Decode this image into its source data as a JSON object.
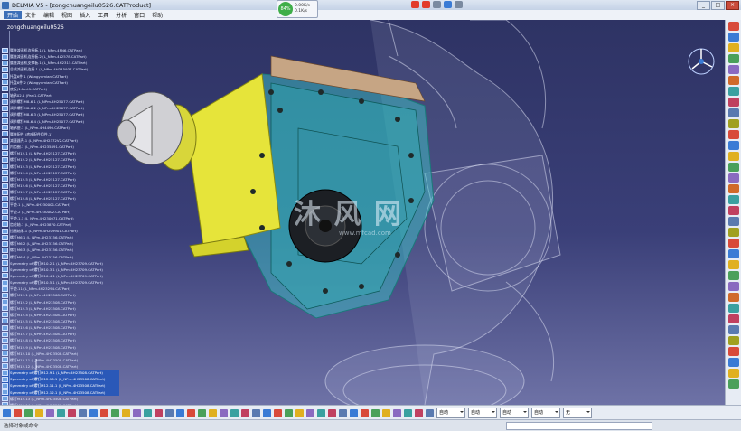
{
  "window": {
    "title": "DELMIA V5 - [zongchuangeilu0526.CATProduct]",
    "buttons": [
      "_",
      "□",
      "×"
    ]
  },
  "menu": {
    "start": "开始",
    "items": [
      "文件",
      "编辑",
      "视图",
      "插入",
      "工具",
      "分析",
      "窗口",
      "帮助"
    ]
  },
  "network": {
    "percent": "84%",
    "up": "0.00K/s",
    "down": "0.1K/s"
  },
  "tree": {
    "root": "zongchuangeilu0526",
    "rows": [
      {
        "text": "腰座减速机连接板.1 (L_NPm-4PN6.CATPart)"
      },
      {
        "text": "腰座减速机连接板.2 (L_NPm-4L2578.CATPart)"
      },
      {
        "text": "腰座减速机支撑板.1 (L_NPm-4H2315.CATPart)"
      },
      {
        "text": "总成减速机连接.1 (L_NPm-4H345937.CATPart)"
      },
      {
        "text": "托盘6件.1 (Wangyumian.CATPart)"
      },
      {
        "text": "托盘6件.2 (Wangyumian.CATPart)"
      },
      {
        "text": "底板(1.Part1.CATPart)"
      },
      {
        "text": "轴承02.1 (Part1.CATPart)"
      },
      {
        "text": "调节螺钉M8-6.1 (L_NPm-4H25077.CATPart)"
      },
      {
        "text": "调节螺钉M8-6.2 (L_NPm-4H25077.CATPart)"
      },
      {
        "text": "调节螺钉M8-6.3 (L_NPm-4H25077.CATPart)"
      },
      {
        "text": "调节螺钉M8-6.4 (L_NPm-4H25077.CATPart)"
      },
      {
        "text": "轴承座.1 (L_NPm-4H4490.CATPart)"
      },
      {
        "text": "腰座配件 (底座配件组件.1)"
      },
      {
        "text": "减速器壳.1 (L_NPm-4H2372V2.CATPart)"
      },
      {
        "text": "内齿圈.1 (L_NPm-4H235891.CATPart)"
      },
      {
        "text": "螺钉M12.1 (L_NPm-4H25127.CATPart)"
      },
      {
        "text": "螺钉M12.2 (L_NPm-4H25127.CATPart)"
      },
      {
        "text": "螺钉M12.3 (L_NPm-4H25127.CATPart)"
      },
      {
        "text": "螺钉M12.4 (L_NPm-4H25127.CATPart)"
      },
      {
        "text": "螺钉M12.5 (L_NPm-4H25127.CATPart)"
      },
      {
        "text": "螺钉M12.6 (L_NPm-4H25127.CATPart)"
      },
      {
        "text": "螺钉M12.7 (L_NPm-4H25127.CATPart)"
      },
      {
        "text": "螺钉M12.8 (L_NPm-4H25127.CATPart)"
      },
      {
        "text": "平垫.1 (L_NPm-4H230001.CATPart)"
      },
      {
        "text": "平垫.2 (L_NPm-4H230002.CATPart)"
      },
      {
        "text": "平垫.1.1 (L_NPm-4H230071.CATPart)"
      },
      {
        "text": "齿轮轴.1 (L_NPm-4H23870.CATPart)"
      },
      {
        "text": "挡圈轴承.1 (L_NPm-4H209901.CATPart)"
      },
      {
        "text": "螺钉M6.1 (L_NPm-4H23156.CATPart)"
      },
      {
        "text": "螺钉M6.2 (L_NPm-4H23156.CATPart)"
      },
      {
        "text": "螺钉M6.3 (L_NPm-4H23156.CATPart)"
      },
      {
        "text": "螺钉M6.4 (L_NPm-4H23156.CATPart)"
      },
      {
        "text": "Symmetry of 螺钉M10.2.1 (L_NPm-4H23709.CATPart)"
      },
      {
        "text": "Symmetry of 螺钉M10.3.1 (L_NPm-4H23709.CATPart)"
      },
      {
        "text": "Symmetry of 螺钉M10.4.1 (L_NPm-4H23709.CATPart)"
      },
      {
        "text": "Symmetry of 螺钉M10.5.1 (L_NPm-4H23709.CATPart)"
      },
      {
        "text": "平垫.11 (L_NPm-4H23294.CATPart)"
      },
      {
        "text": "螺钉M12.1 (L_NPm-4H23508.CATPart)"
      },
      {
        "text": "螺钉M12.2 (L_NPm-4H23508.CATPart)"
      },
      {
        "text": "螺钉M12.3 (L_NPm-4H23508.CATPart)"
      },
      {
        "text": "螺钉M12.4 (L_NPm-4H23508.CATPart)"
      },
      {
        "text": "螺钉M12.5 (L_NPm-4H23508.CATPart)"
      },
      {
        "text": "螺钉M12.6 (L_NPm-4H23508.CATPart)"
      },
      {
        "text": "螺钉M12.7 (L_NPm-4H23508.CATPart)"
      },
      {
        "text": "螺钉M12.8 (L_NPm-4H23508.CATPart)"
      },
      {
        "text": "螺钉M12.9 (L_NPm-4H23508.CATPart)"
      },
      {
        "text": "螺钉M12.10 (L_NPm-4H23508.CATPart)"
      },
      {
        "text": "螺钉M12.11 (L_NPm-4H23508.CATPart)"
      },
      {
        "text": "螺钉M12.12 (L_NPm-4H23508.CATPart)"
      },
      {
        "text": "Symmetry of 螺钉M12.9.1 (L_NPm-4H23508.CATPart)"
      },
      {
        "text": "Symmetry of 螺钉M12.10.1 (L_NPm-4H23508.CATPart)"
      },
      {
        "text": "Symmetry of 螺钉M12.11.1 (L_NPm-4H23508.CATPart)"
      },
      {
        "text": "Symmetry of 螺钉M12.12.1 (L_NPm-4H23508.CATPart)"
      },
      {
        "text": "螺钉M12.13 (L_NPm-4H23508.CATPart)"
      },
      {
        "text": "螺钉M12.14 (L_NPm-4H23508.CATPart)"
      },
      {
        "text": "螺钉M12.15 (L_NPm-4H23508.CATPart)"
      }
    ]
  },
  "watermark": {
    "text": "沐 风 网",
    "url": "www.mfcad.com"
  },
  "bottom": {
    "select1": "自动",
    "select2": "自动",
    "select3": "自动",
    "select4": "自动",
    "select5": "无"
  },
  "status": {
    "message": "选择对象或命令"
  },
  "colors": {
    "viewport_top": "#2e3364",
    "viewport_bottom": "#6e72a6",
    "selection": "#2a58b8",
    "yellow_part": "#e6e43a",
    "cyan_part": "#3fd0d0"
  }
}
